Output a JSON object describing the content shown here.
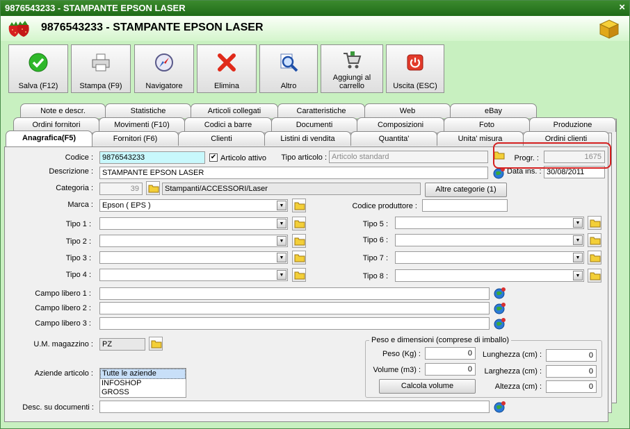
{
  "window": {
    "title": "9876543233 - STAMPANTE EPSON LASER",
    "close": "×"
  },
  "header": {
    "title": "9876543233 - STAMPANTE EPSON LASER"
  },
  "toolbar": {
    "save": "Salva (F12)",
    "print": "Stampa (F9)",
    "navigator": "Navigatore",
    "delete": "Elimina",
    "other": "Altro",
    "add_cart": "Aggiungi al carrello",
    "exit": "Uscita (ESC)"
  },
  "tabs_row1": [
    "Note e descr.",
    "Statistiche",
    "Articoli collegati",
    "Caratteristiche",
    "Web",
    "eBay"
  ],
  "tabs_row2": [
    "Ordini fornitori",
    "Movimenti (F10)",
    "Codici a barre",
    "Documenti",
    "Composizioni",
    "Foto",
    "Produzione"
  ],
  "tabs_row3": [
    "Anagrafica(F5)",
    "Fornitori (F6)",
    "Clienti",
    "Listini di vendita",
    "Quantita'",
    "Unita' misura",
    "Ordini clienti"
  ],
  "form": {
    "codice_label": "Codice :",
    "codice": "9876543233",
    "articolo_attivo": "Articolo attivo",
    "tipo_articolo_label": "Tipo articolo :",
    "tipo_articolo": "Articolo standard",
    "progr_label": "Progr. :",
    "progr": "1675",
    "descrizione_label": "Descrizione :",
    "descrizione": "STAMPANTE EPSON LASER",
    "data_label": "Data ins. :",
    "data": "30/08/2011",
    "categoria_label": "Categoria :",
    "categoria_num": "39",
    "categoria_path": "Stampanti/ACCESSORI/Laser",
    "altre_categorie": "Altre categorie (1)",
    "marca_label": "Marca :",
    "marca": "Epson ( EPS )",
    "codice_produttore_label": "Codice produttore :",
    "tipo1_label": "Tipo 1 :",
    "tipo2_label": "Tipo 2 :",
    "tipo3_label": "Tipo 3 :",
    "tipo4_label": "Tipo 4 :",
    "tipo5_label": "Tipo 5 :",
    "tipo6_label": "Tipo 6 :",
    "tipo7_label": "Tipo 7 :",
    "tipo8_label": "Tipo 8 :",
    "campo1_label": "Campo libero 1 :",
    "campo2_label": "Campo libero 2 :",
    "campo3_label": "Campo libero 3 :",
    "um_label": "U.M. magazzino :",
    "um": "PZ",
    "aziende_label": "Aziende articolo :",
    "aziende": [
      "Tutte le aziende",
      "INFOSHOP",
      "GROSS"
    ],
    "desc_doc_label": "Desc. su documenti :"
  },
  "peso": {
    "title": "Peso e dimensioni (comprese di imballo)",
    "peso_label": "Peso (Kg) :",
    "peso": "0",
    "volume_label": "Volume (m3) :",
    "volume": "0",
    "calcola": "Calcola volume",
    "lunghezza_label": "Lunghezza (cm) :",
    "lunghezza": "0",
    "larghezza_label": "Larghezza (cm) :",
    "larghezza": "0",
    "altezza_label": "Altezza (cm) :",
    "altezza": "0"
  }
}
